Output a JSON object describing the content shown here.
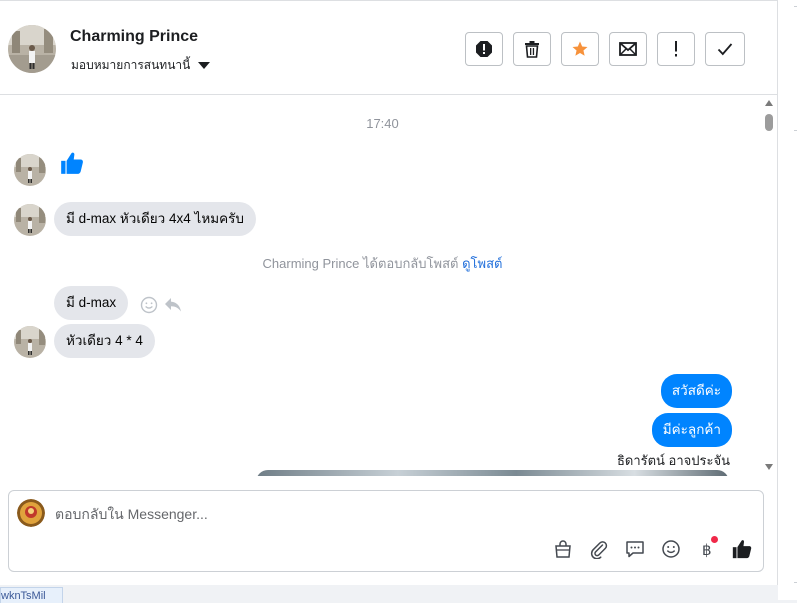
{
  "header": {
    "contact_name": "Charming Prince",
    "assign_label": "มอบหมายการสนทนานี้",
    "actions": [
      {
        "name": "spam-button",
        "icon": "alert-octagon-icon"
      },
      {
        "name": "delete-button",
        "icon": "trash-icon"
      },
      {
        "name": "star-button",
        "icon": "star-icon"
      },
      {
        "name": "mark-unread-button",
        "icon": "envelope-icon"
      },
      {
        "name": "follow-up-button",
        "icon": "exclamation-icon"
      },
      {
        "name": "mark-done-button",
        "icon": "check-icon"
      }
    ],
    "star_color": "#f7923b"
  },
  "conversation": {
    "timestamp": "17:40",
    "incoming": [
      {
        "type": "like"
      },
      {
        "text": "มี d-max หัวเดียว 4x4 ไหมครับ"
      },
      {
        "text": "มี d-max"
      },
      {
        "text": "หัวเดียว 4 * 4"
      }
    ],
    "system_text": "Charming Prince ได้ตอบกลับโพสต์",
    "system_link": "ดูโพสต์",
    "outgoing": [
      {
        "text": "สวัสดีค่ะ"
      },
      {
        "text": "มีค่ะลูกค้า"
      }
    ],
    "sender_name": "ธิดารัตน์ อาจประจัน",
    "outgoing_color": "#0084ff",
    "incoming_color": "#e4e6eb"
  },
  "composer": {
    "placeholder": "ตอบกลับใน Messenger...",
    "icons": [
      "shopping-bag-icon",
      "paperclip-icon",
      "saved-reply-icon",
      "emoji-icon",
      "baht-icon",
      "thumbs-up-icon"
    ]
  },
  "bottom_tab": {
    "label": "wknTsMil"
  }
}
